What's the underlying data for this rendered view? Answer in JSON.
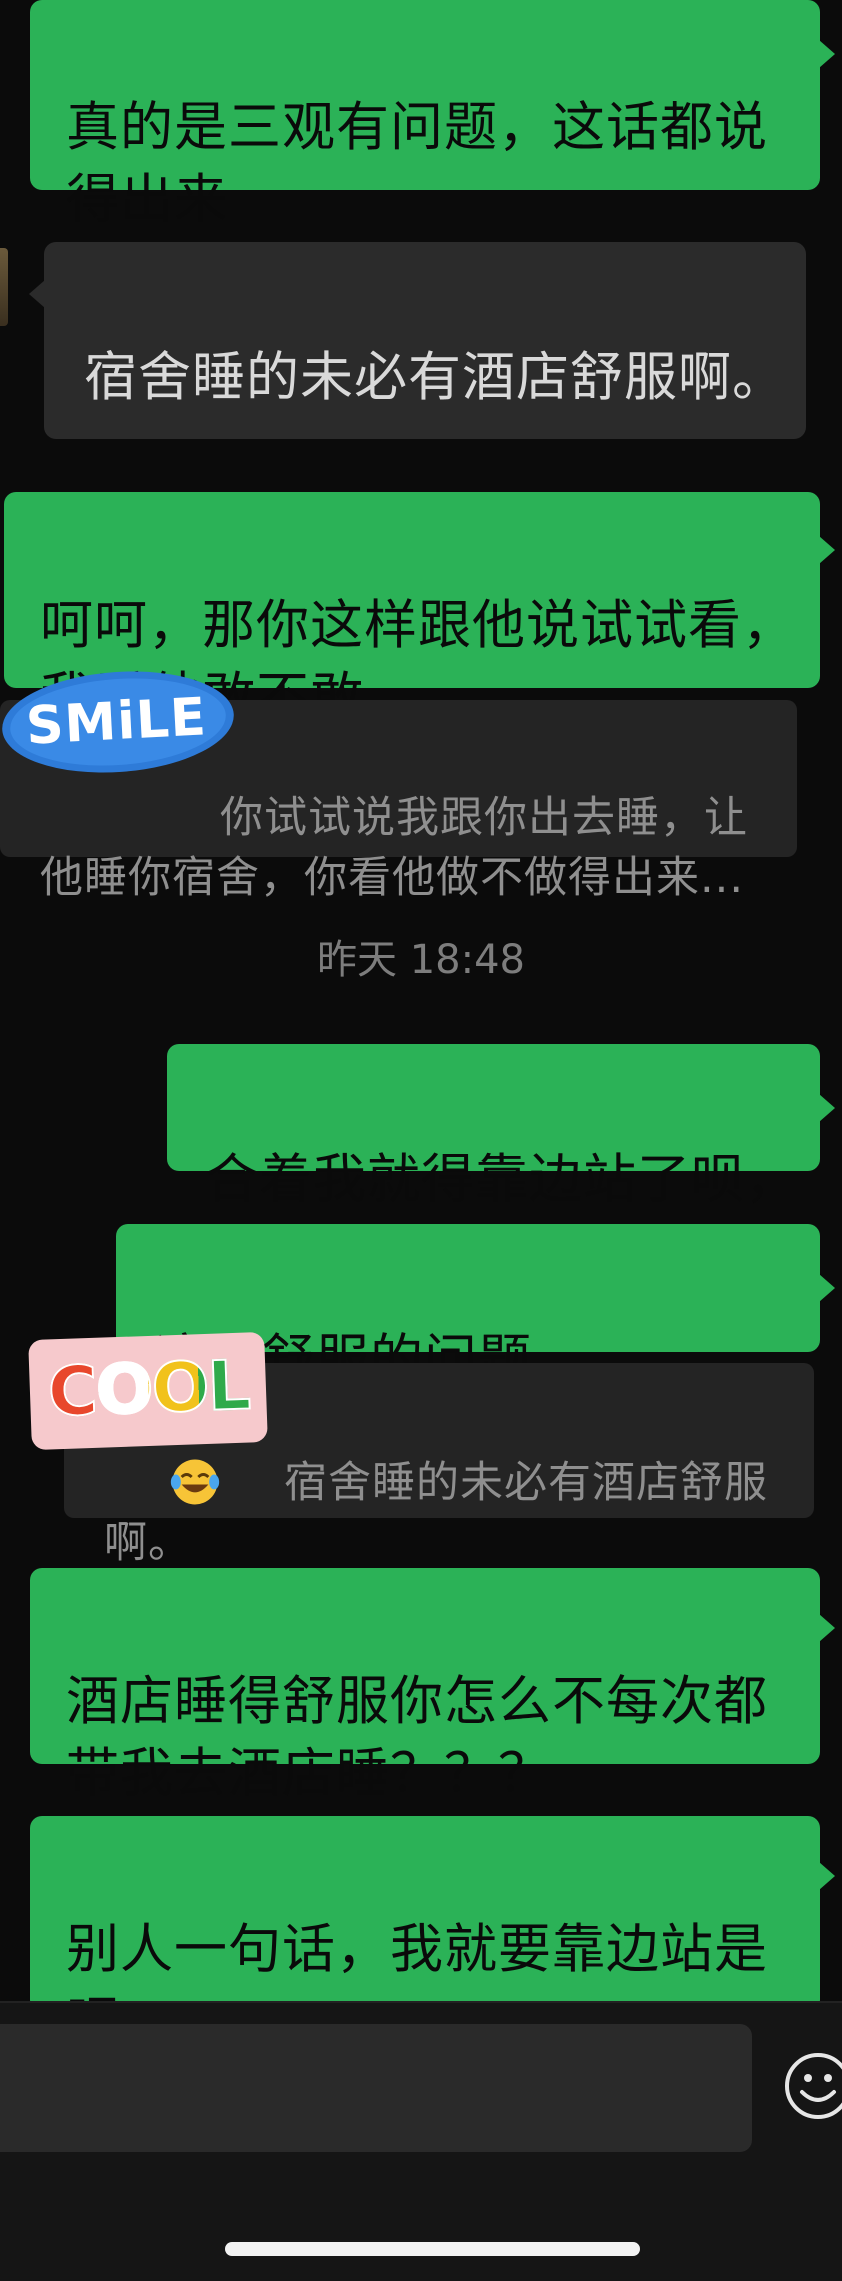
{
  "messages": [
    {
      "side": "right",
      "text": "真的是三观有问题，这话都说\n得出来"
    },
    {
      "side": "left",
      "text": "宿舍睡的未必有酒店舒服啊。"
    },
    {
      "side": "right",
      "text": "呵呵，那你这样跟他说试试看，\n我看他敢不敢"
    },
    {
      "side": "quote",
      "text": "你试试说我跟你出去睡，让\n他睡你宿舍，你看他做不做得出来..."
    },
    {
      "side": "right",
      "text": "合着我就得靠边站了呗，"
    },
    {
      "side": "right",
      "text": "这是舒服的问题吗？？？？？"
    },
    {
      "side": "quote",
      "text": "宿舍睡的未必有酒店舒服\n啊。"
    },
    {
      "side": "right",
      "text": "酒店睡得舒服你怎么不每次都\n带我去酒店睡？？？"
    },
    {
      "side": "right",
      "text": "别人一句话，我就要靠边站是\n吧"
    }
  ],
  "timestamp": "昨天 18:48",
  "stickers": {
    "smile": "SMiLE",
    "cool": "COOL"
  },
  "icons": {
    "emoji_in_message": "tears-of-joy-emoji",
    "emoji_button": "smiley-face-icon"
  },
  "colors": {
    "outgoing_bubble": "#2bb257",
    "incoming_bubble": "#2b2b2b",
    "background": "#0b0b0b"
  }
}
